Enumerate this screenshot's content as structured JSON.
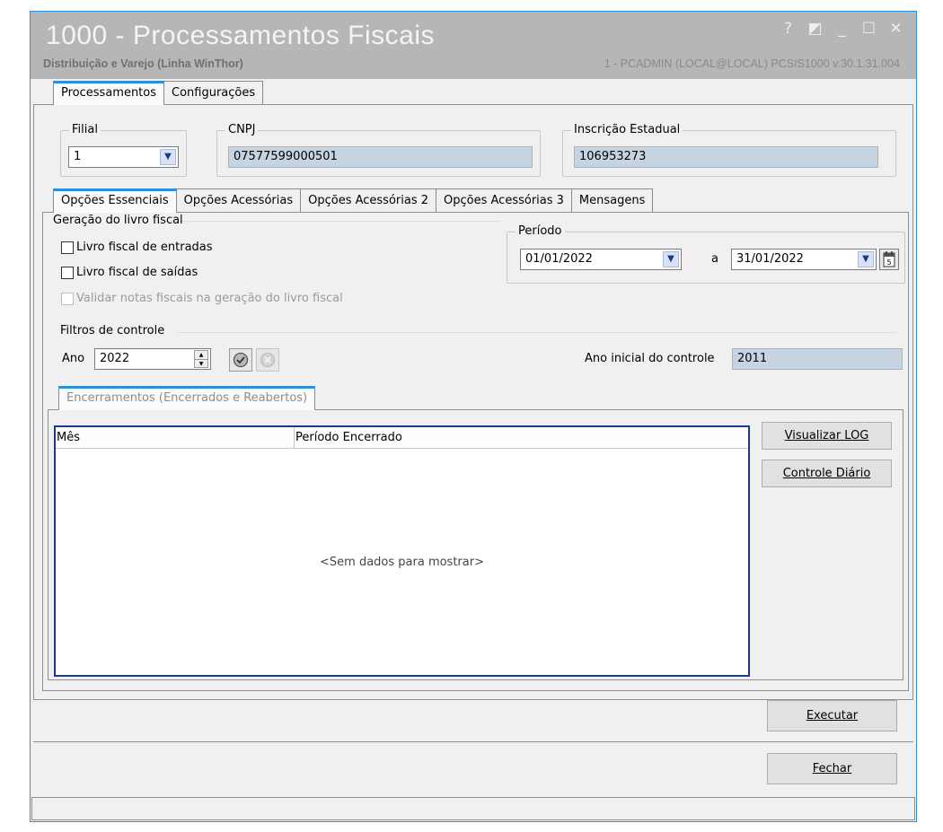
{
  "window": {
    "title": "1000 - Processamentos Fiscais",
    "subtitle": "Distribuição e Varejo (Linha WinThor)",
    "user_info": "1 - PCADMIN (LOCAL@LOCAL)  PCSIS1000  v.30.1.31.004",
    "controls": {
      "help": "?",
      "restore": "◩",
      "minimize": "_",
      "maximize": "☐",
      "close": "✕"
    }
  },
  "main_tabs": [
    {
      "label": "Processamentos",
      "active": true
    },
    {
      "label": "Configurações",
      "active": false
    }
  ],
  "header_fields": {
    "filial": {
      "label": "Filial",
      "value": "1"
    },
    "cnpj": {
      "label": "CNPJ",
      "value": "07577599000501"
    },
    "inscricao": {
      "label": "Inscrição Estadual",
      "value": "106953273"
    }
  },
  "sub_tabs": [
    {
      "label": "Opções Essenciais",
      "active": true
    },
    {
      "label": "Opções Acessórias",
      "active": false
    },
    {
      "label": "Opções Acessórias 2",
      "active": false
    },
    {
      "label": "Opções Acessórias 3",
      "active": false
    },
    {
      "label": "Mensagens",
      "active": false
    }
  ],
  "geracao": {
    "label": "Geração do livro fiscal",
    "entradas": "Livro fiscal de entradas",
    "saidas": "Livro fiscal de saídas",
    "validar": "Validar notas fiscais na geração do livro fiscal"
  },
  "periodo": {
    "label": "Período",
    "start": "01/01/2022",
    "sep": "a",
    "end": "31/01/2022"
  },
  "filtros": {
    "label": "Filtros de controle",
    "ano_label": "Ano",
    "ano_value": "2022",
    "ano_inicial_label": "Ano inicial do controle",
    "ano_inicial_value": "2011"
  },
  "encerramentos": {
    "tab_label": "Encerramentos (Encerrados e Reabertos)",
    "columns": [
      "Mês",
      "Período Encerrado"
    ],
    "empty_text": "<Sem dados para mostrar>",
    "visualizar_log": "Visualizar LOG",
    "controle_diario": "Controle Diário"
  },
  "footer": {
    "executar": "Executar",
    "fechar": "Fechar"
  },
  "colors": {
    "accent": "#2b8fd9",
    "titlebar": "#b6b6b6",
    "readonly_field": "#c5d4e0",
    "grid_border": "#1c3a8a"
  }
}
